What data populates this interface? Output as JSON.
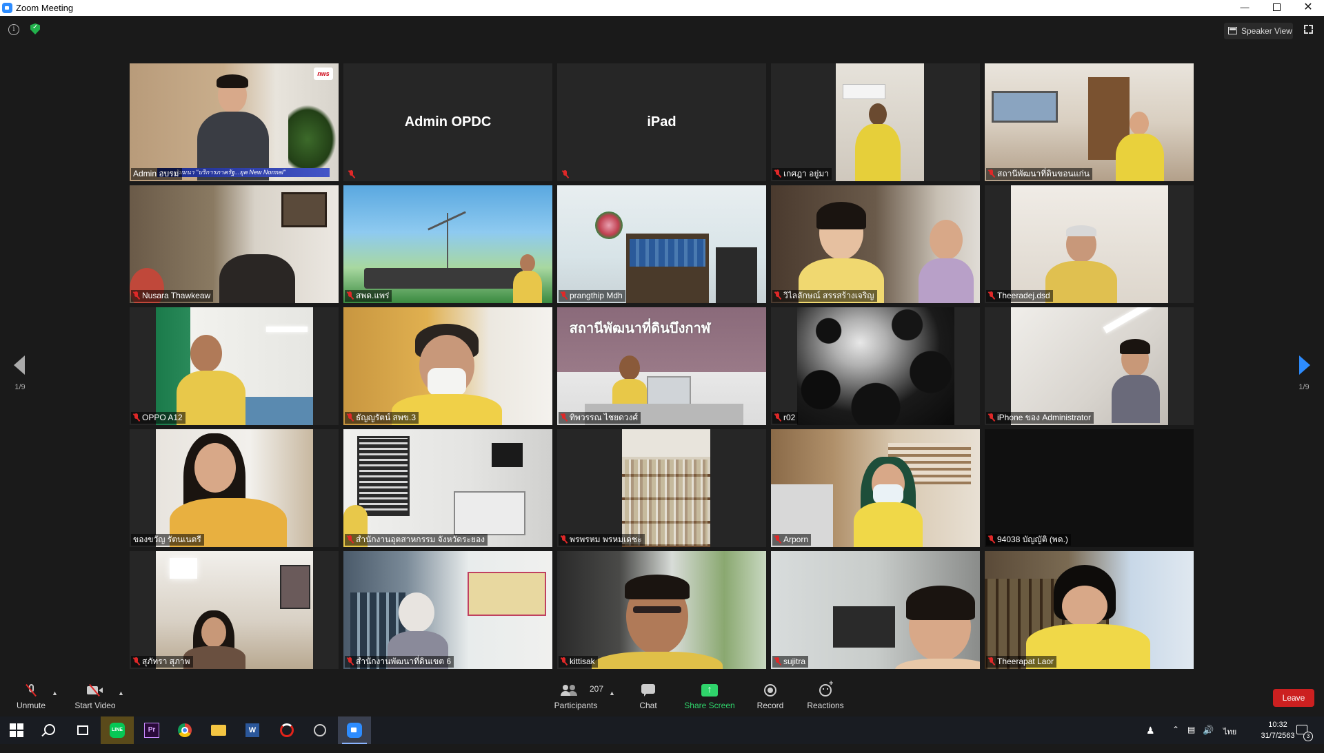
{
  "window": {
    "title": "Zoom Meeting"
  },
  "header": {
    "speaker_view_label": "Speaker View"
  },
  "pagination": {
    "left": "1/9",
    "right": "1/9"
  },
  "tiles": [
    {
      "name": "Admin อบรม",
      "tv_logo": "nws",
      "lower_third": "ระบบสัมมนา \"บริการภาครัฐ...ยุค New Normal\""
    },
    {
      "name": "Admin OPDC"
    },
    {
      "name": "iPad"
    },
    {
      "name": "เกศฎา  อยู่มา"
    },
    {
      "name": "สถานีพัฒนาที่ดินขอนแก่น"
    },
    {
      "name": "Nusara Thawkeaw"
    },
    {
      "name": "สพด.แพร่"
    },
    {
      "name": "prangthip Mdh"
    },
    {
      "name": "วิไลลักษณ์ สรรสร้างเจริญ"
    },
    {
      "name": "Theeradej.dsd"
    },
    {
      "name": "OPPO A12"
    },
    {
      "name": "ธัญญรัตน์ สพข.3"
    },
    {
      "name": "ทิพวรรณ ไชยดวงศ์",
      "sign": "สถานีพัฒนาที่ดินบึงกาฬ"
    },
    {
      "name": "r02"
    },
    {
      "name": "iPhone ของ Administrator"
    },
    {
      "name": "ของขวัญ รัตนเนตรี"
    },
    {
      "name": "สำนักงานอุตสาหกรรม จังหวัดระยอง"
    },
    {
      "name": "พรพรหม พรหมเดชะ"
    },
    {
      "name": "Arporn"
    },
    {
      "name": "94038 บัญญัติ (พด.)"
    },
    {
      "name": "สุภัทรา สุภาพ"
    },
    {
      "name": "สำนักงานพัฒนาที่ดินเขต 6"
    },
    {
      "name": "kittisak"
    },
    {
      "name": "sujitra"
    },
    {
      "name": "Theerapat Laor"
    }
  ],
  "toolbar": {
    "unmute": "Unmute",
    "start_video": "Start Video",
    "participants": "Participants",
    "participants_count": "207",
    "chat": "Chat",
    "share_screen": "Share Screen",
    "record": "Record",
    "reactions": "Reactions",
    "leave": "Leave"
  },
  "taskbar": {
    "apps": [
      "start-icon",
      "search-icon",
      "task-view-icon",
      "line-icon",
      "premiere-icon",
      "chrome-icon",
      "file-explorer-icon",
      "word-icon",
      "creative-cloud-icon",
      "browser-globe-icon",
      "zoom-icon"
    ],
    "premiere_label": "Pr",
    "word_label": "W",
    "line_label": "LINE",
    "ime_label": "ไทย",
    "time": "10:32",
    "date": "31/7/2563",
    "notifications": "3"
  },
  "colors": {
    "accent": "#2d8cff",
    "active_speaker": "#c8e64a",
    "leave": "#cc2020",
    "share_green": "#2fd46b"
  }
}
